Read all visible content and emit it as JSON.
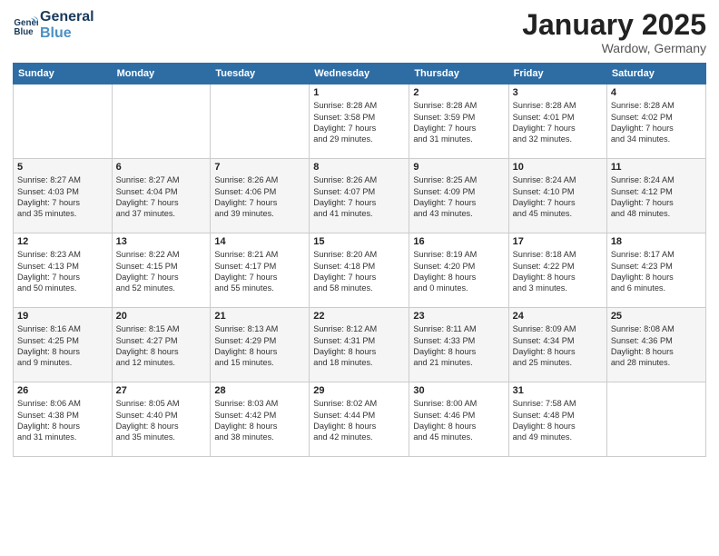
{
  "header": {
    "logo_line1": "General",
    "logo_line2": "Blue",
    "month": "January 2025",
    "location": "Wardow, Germany"
  },
  "weekdays": [
    "Sunday",
    "Monday",
    "Tuesday",
    "Wednesday",
    "Thursday",
    "Friday",
    "Saturday"
  ],
  "weeks": [
    [
      {
        "day": "",
        "info": ""
      },
      {
        "day": "",
        "info": ""
      },
      {
        "day": "",
        "info": ""
      },
      {
        "day": "1",
        "info": "Sunrise: 8:28 AM\nSunset: 3:58 PM\nDaylight: 7 hours\nand 29 minutes."
      },
      {
        "day": "2",
        "info": "Sunrise: 8:28 AM\nSunset: 3:59 PM\nDaylight: 7 hours\nand 31 minutes."
      },
      {
        "day": "3",
        "info": "Sunrise: 8:28 AM\nSunset: 4:01 PM\nDaylight: 7 hours\nand 32 minutes."
      },
      {
        "day": "4",
        "info": "Sunrise: 8:28 AM\nSunset: 4:02 PM\nDaylight: 7 hours\nand 34 minutes."
      }
    ],
    [
      {
        "day": "5",
        "info": "Sunrise: 8:27 AM\nSunset: 4:03 PM\nDaylight: 7 hours\nand 35 minutes."
      },
      {
        "day": "6",
        "info": "Sunrise: 8:27 AM\nSunset: 4:04 PM\nDaylight: 7 hours\nand 37 minutes."
      },
      {
        "day": "7",
        "info": "Sunrise: 8:26 AM\nSunset: 4:06 PM\nDaylight: 7 hours\nand 39 minutes."
      },
      {
        "day": "8",
        "info": "Sunrise: 8:26 AM\nSunset: 4:07 PM\nDaylight: 7 hours\nand 41 minutes."
      },
      {
        "day": "9",
        "info": "Sunrise: 8:25 AM\nSunset: 4:09 PM\nDaylight: 7 hours\nand 43 minutes."
      },
      {
        "day": "10",
        "info": "Sunrise: 8:24 AM\nSunset: 4:10 PM\nDaylight: 7 hours\nand 45 minutes."
      },
      {
        "day": "11",
        "info": "Sunrise: 8:24 AM\nSunset: 4:12 PM\nDaylight: 7 hours\nand 48 minutes."
      }
    ],
    [
      {
        "day": "12",
        "info": "Sunrise: 8:23 AM\nSunset: 4:13 PM\nDaylight: 7 hours\nand 50 minutes."
      },
      {
        "day": "13",
        "info": "Sunrise: 8:22 AM\nSunset: 4:15 PM\nDaylight: 7 hours\nand 52 minutes."
      },
      {
        "day": "14",
        "info": "Sunrise: 8:21 AM\nSunset: 4:17 PM\nDaylight: 7 hours\nand 55 minutes."
      },
      {
        "day": "15",
        "info": "Sunrise: 8:20 AM\nSunset: 4:18 PM\nDaylight: 7 hours\nand 58 minutes."
      },
      {
        "day": "16",
        "info": "Sunrise: 8:19 AM\nSunset: 4:20 PM\nDaylight: 8 hours\nand 0 minutes."
      },
      {
        "day": "17",
        "info": "Sunrise: 8:18 AM\nSunset: 4:22 PM\nDaylight: 8 hours\nand 3 minutes."
      },
      {
        "day": "18",
        "info": "Sunrise: 8:17 AM\nSunset: 4:23 PM\nDaylight: 8 hours\nand 6 minutes."
      }
    ],
    [
      {
        "day": "19",
        "info": "Sunrise: 8:16 AM\nSunset: 4:25 PM\nDaylight: 8 hours\nand 9 minutes."
      },
      {
        "day": "20",
        "info": "Sunrise: 8:15 AM\nSunset: 4:27 PM\nDaylight: 8 hours\nand 12 minutes."
      },
      {
        "day": "21",
        "info": "Sunrise: 8:13 AM\nSunset: 4:29 PM\nDaylight: 8 hours\nand 15 minutes."
      },
      {
        "day": "22",
        "info": "Sunrise: 8:12 AM\nSunset: 4:31 PM\nDaylight: 8 hours\nand 18 minutes."
      },
      {
        "day": "23",
        "info": "Sunrise: 8:11 AM\nSunset: 4:33 PM\nDaylight: 8 hours\nand 21 minutes."
      },
      {
        "day": "24",
        "info": "Sunrise: 8:09 AM\nSunset: 4:34 PM\nDaylight: 8 hours\nand 25 minutes."
      },
      {
        "day": "25",
        "info": "Sunrise: 8:08 AM\nSunset: 4:36 PM\nDaylight: 8 hours\nand 28 minutes."
      }
    ],
    [
      {
        "day": "26",
        "info": "Sunrise: 8:06 AM\nSunset: 4:38 PM\nDaylight: 8 hours\nand 31 minutes."
      },
      {
        "day": "27",
        "info": "Sunrise: 8:05 AM\nSunset: 4:40 PM\nDaylight: 8 hours\nand 35 minutes."
      },
      {
        "day": "28",
        "info": "Sunrise: 8:03 AM\nSunset: 4:42 PM\nDaylight: 8 hours\nand 38 minutes."
      },
      {
        "day": "29",
        "info": "Sunrise: 8:02 AM\nSunset: 4:44 PM\nDaylight: 8 hours\nand 42 minutes."
      },
      {
        "day": "30",
        "info": "Sunrise: 8:00 AM\nSunset: 4:46 PM\nDaylight: 8 hours\nand 45 minutes."
      },
      {
        "day": "31",
        "info": "Sunrise: 7:58 AM\nSunset: 4:48 PM\nDaylight: 8 hours\nand 49 minutes."
      },
      {
        "day": "",
        "info": ""
      }
    ]
  ]
}
